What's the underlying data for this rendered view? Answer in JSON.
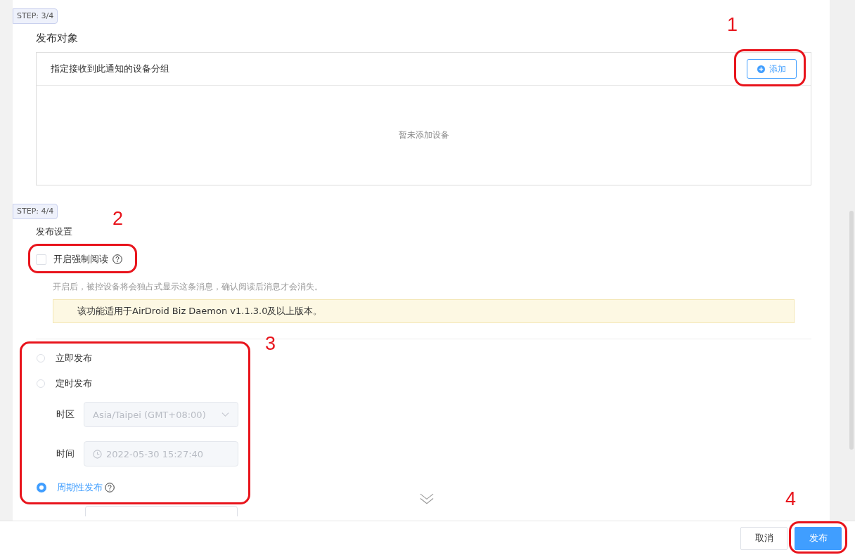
{
  "target_section": {
    "step": "STEP: 3/4",
    "title": "发布对象",
    "box_header": "指定接收到此通知的设备分组",
    "add_button": "添加",
    "empty_text": "暂未添加设备"
  },
  "settings_section": {
    "step": "STEP: 4/4",
    "title": "发布设置",
    "force_read": {
      "label": "开启强制阅读",
      "checked": false
    },
    "hint": "开启后，被控设备将会独占式显示这条消息，确认阅读后消息才会消失。",
    "notice": "该功能适用于AirDroid Biz Daemon v1.1.3.0及以上版本。"
  },
  "publish_modes": [
    {
      "label": "立即发布",
      "selected": false,
      "help": false
    },
    {
      "label": "定时发布",
      "selected": false,
      "help": false,
      "fields": [
        {
          "label": "时区",
          "kind": "select",
          "value": "Asia/Taipei (GMT+08:00)",
          "disabled": true
        },
        {
          "label": "时间",
          "kind": "time",
          "value": "2022-05-30 15:27:40",
          "disabled": true
        }
      ]
    },
    {
      "label": "周期性发布",
      "selected": true,
      "help": true
    }
  ],
  "footer_buttons": [
    {
      "label": "取消",
      "primary": false
    },
    {
      "label": "发布",
      "primary": true
    }
  ],
  "annotations": [
    {
      "label": "1"
    },
    {
      "label": "2"
    },
    {
      "label": "3"
    },
    {
      "label": "4"
    }
  ]
}
